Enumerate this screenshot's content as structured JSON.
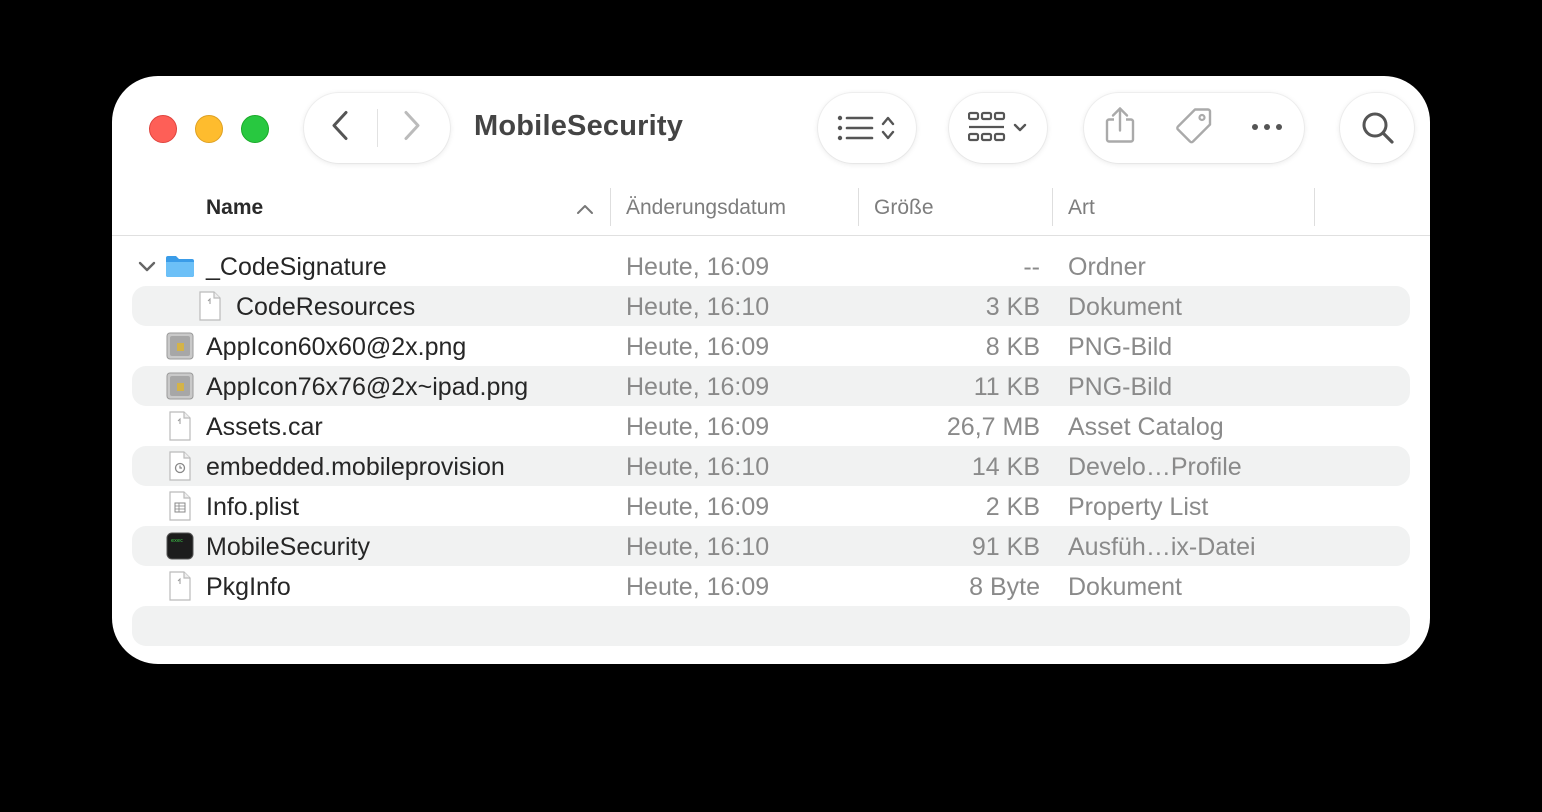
{
  "window": {
    "title": "MobileSecurity"
  },
  "toolbar": {
    "back": "chevron-left-icon",
    "forward": "chevron-right-icon",
    "list_view": "list-view-icon",
    "group": "grid-view-icon",
    "share": "share-icon",
    "tag": "tag-icon",
    "more": "more-icon",
    "search": "search-icon"
  },
  "columns": {
    "name": "Name",
    "date": "Änderungsdatum",
    "size": "Größe",
    "kind": "Art"
  },
  "files": [
    {
      "name": "_CodeSignature",
      "date": "Heute, 16:09",
      "size": "--",
      "kind": "Ordner",
      "icon": "folder-icon",
      "expanded": true
    },
    {
      "name": "CodeResources",
      "date": "Heute, 16:10",
      "size": "3 KB",
      "kind": "Dokument",
      "icon": "document-icon"
    },
    {
      "name": "AppIcon60x60@2x.png",
      "date": "Heute, 16:09",
      "size": "8 KB",
      "kind": "PNG-Bild",
      "icon": "image-icon"
    },
    {
      "name": "AppIcon76x76@2x~ipad.png",
      "date": "Heute, 16:09",
      "size": "11 KB",
      "kind": "PNG-Bild",
      "icon": "image-icon"
    },
    {
      "name": "Assets.car",
      "date": "Heute, 16:09",
      "size": "26,7 MB",
      "kind": "Asset Catalog",
      "icon": "document-icon"
    },
    {
      "name": "embedded.mobileprovision",
      "date": "Heute, 16:10",
      "size": "14 KB",
      "kind": "Develo…Profile",
      "icon": "provision-icon"
    },
    {
      "name": "Info.plist",
      "date": "Heute, 16:09",
      "size": "2 KB",
      "kind": "Property List",
      "icon": "plist-icon"
    },
    {
      "name": "MobileSecurity",
      "date": "Heute, 16:10",
      "size": "91 KB",
      "kind": "Ausfüh…ix-Datei",
      "icon": "executable-icon"
    },
    {
      "name": "PkgInfo",
      "date": "Heute, 16:09",
      "size": "8 Byte",
      "kind": "Dokument",
      "icon": "document-icon"
    }
  ]
}
